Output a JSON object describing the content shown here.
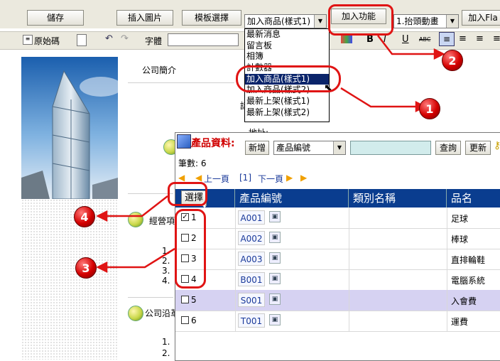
{
  "toolbar": {
    "save": "儲存",
    "insert_image": "插入圖片",
    "template_select": "模板選擇",
    "product_style_select": "加入商品(樣式1)",
    "add_function": "加入功能",
    "marquee_select": "1.抬頭動畫",
    "add_flash": "加入Fla",
    "source_code": "原始碼",
    "font_label": "字體"
  },
  "function_menu": {
    "items": [
      "最新消息",
      "留言板",
      "相簿",
      "計數器",
      "加入商品(樣式1)",
      "加入商品(樣式2)",
      "最新上架(樣式1)",
      "最新上架(樣式2)"
    ],
    "selected": "加入商品(樣式1)"
  },
  "page": {
    "section_company_intro": "公司簡介",
    "section_business": "經營項",
    "section_history": "公司沿革",
    "address_partial": "地址:",
    "phone_partial": "話",
    "list_items": [
      "1.",
      "2.",
      "3.",
      "4."
    ],
    "history_items": [
      "1.",
      "2."
    ]
  },
  "product_panel": {
    "title": "產品資料:",
    "add_button": "新增",
    "field_select": "產品編號",
    "search_value": "",
    "query_button": "查詢",
    "update_button": "更新",
    "count_text": "筆數: 6",
    "prev_page": "上一頁",
    "current_page": "[1]",
    "next_page": "下一頁",
    "columns": [
      "選擇",
      "產品編號",
      "類別名稱",
      "品名"
    ],
    "rows": [
      {
        "num": "1",
        "code": "A001",
        "category": "",
        "name": "足球",
        "checked": true
      },
      {
        "num": "2",
        "code": "A002",
        "category": "",
        "name": "棒球",
        "checked": false
      },
      {
        "num": "3",
        "code": "A003",
        "category": "",
        "name": "直排輪鞋",
        "checked": false
      },
      {
        "num": "4",
        "code": "B001",
        "category": "",
        "name": "電腦系統",
        "checked": false
      },
      {
        "num": "5",
        "code": "S001",
        "category": "",
        "name": "入會費",
        "checked": false
      },
      {
        "num": "6",
        "code": "T001",
        "category": "",
        "name": "運費",
        "checked": false
      }
    ]
  },
  "callouts": [
    "1",
    "2",
    "3",
    "4"
  ],
  "colors": {
    "accent_red": "#e01414",
    "header_blue": "#0a3d8f",
    "row_purple": "#d6d2f2",
    "menu_highlight": "#0a246a"
  }
}
